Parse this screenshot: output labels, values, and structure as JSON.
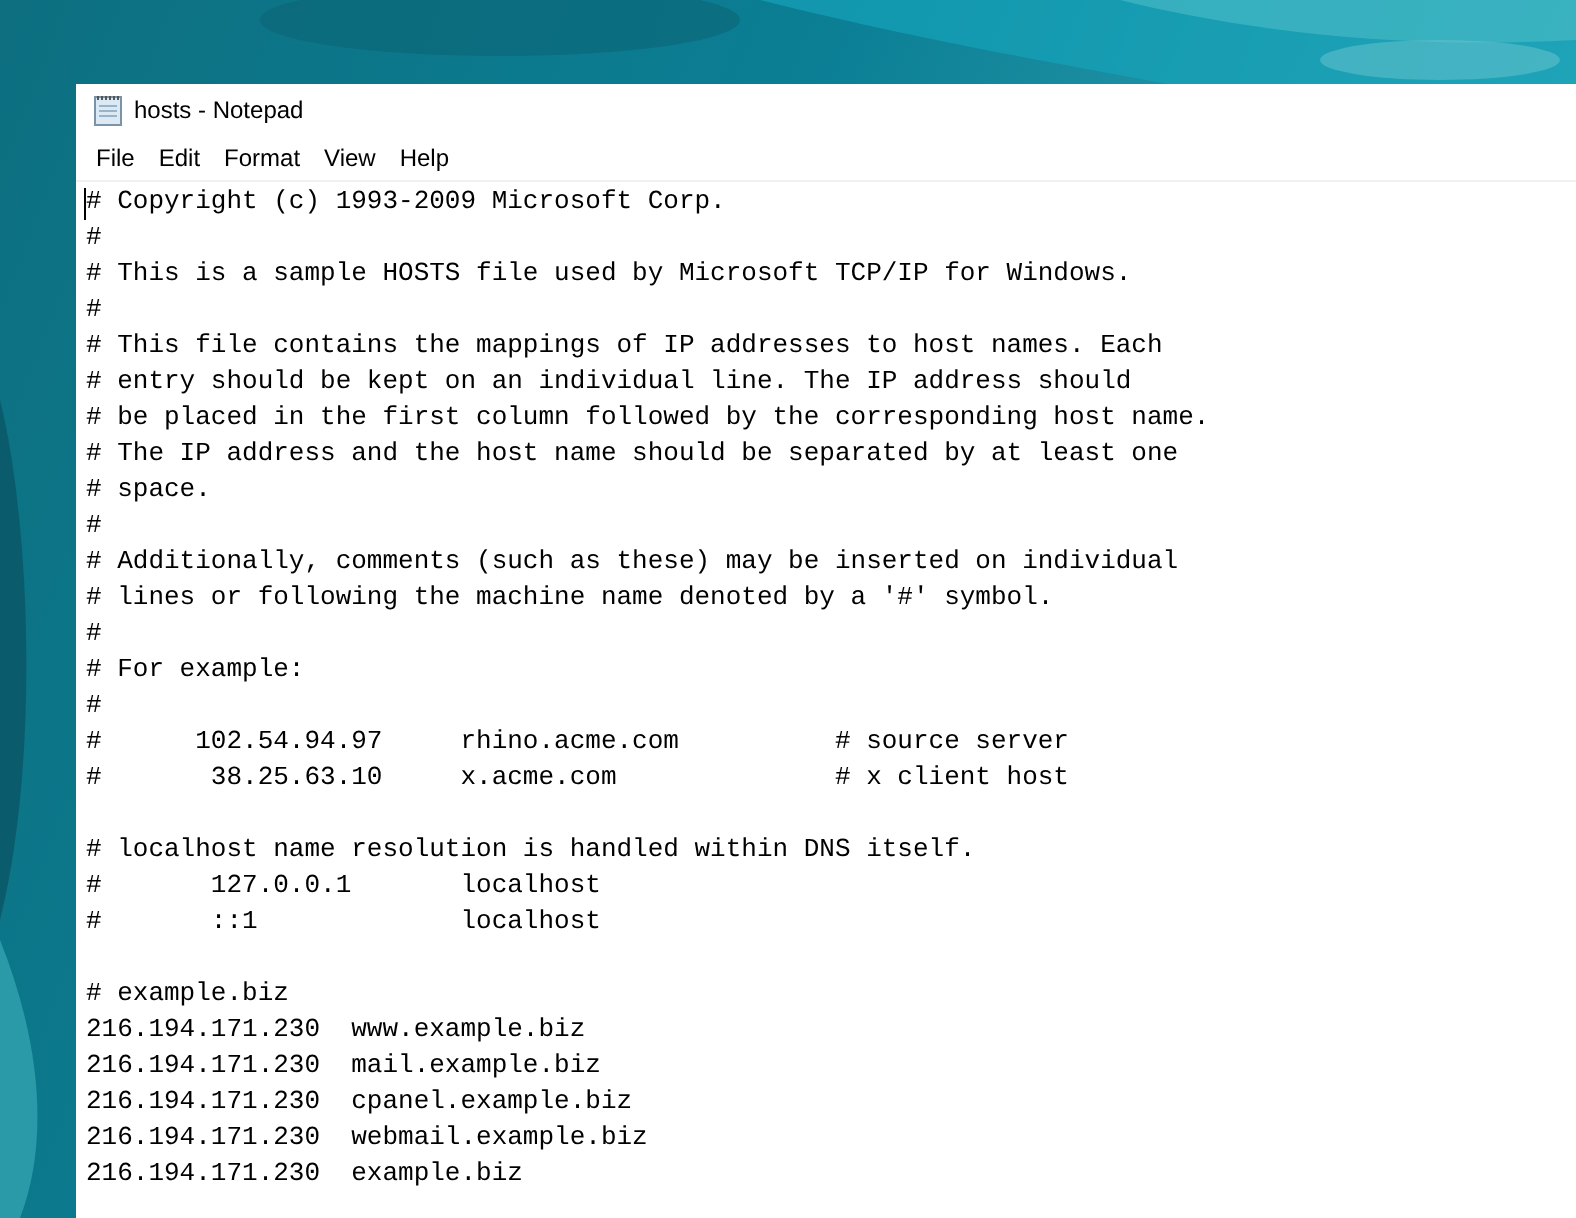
{
  "window": {
    "title": "hosts - Notepad"
  },
  "menu": [
    "File",
    "Edit",
    "Format",
    "View",
    "Help"
  ],
  "editor": {
    "cursor": true,
    "lines": [
      {
        "kind": "text",
        "text": "# Copyright (c) 1993-2009 Microsoft Corp."
      },
      {
        "kind": "text",
        "text": "#"
      },
      {
        "kind": "text",
        "text": "# This is a sample HOSTS file used by Microsoft TCP/IP for Windows."
      },
      {
        "kind": "text",
        "text": "#"
      },
      {
        "kind": "text",
        "text": "# This file contains the mappings of IP addresses to host names. Each"
      },
      {
        "kind": "text",
        "text": "# entry should be kept on an individual line. The IP address should"
      },
      {
        "kind": "text",
        "text": "# be placed in the first column followed by the corresponding host name."
      },
      {
        "kind": "text",
        "text": "# The IP address and the host name should be separated by at least one"
      },
      {
        "kind": "text",
        "text": "# space."
      },
      {
        "kind": "text",
        "text": "#"
      },
      {
        "kind": "text",
        "text": "# Additionally, comments (such as these) may be inserted on individual"
      },
      {
        "kind": "text",
        "text": "# lines or following the machine name denoted by a '#' symbol."
      },
      {
        "kind": "text",
        "text": "#"
      },
      {
        "kind": "text",
        "text": "# For example:"
      },
      {
        "kind": "text",
        "text": "#"
      },
      {
        "kind": "text",
        "text": "#      102.54.94.97     rhino.acme.com          # source server"
      },
      {
        "kind": "text",
        "text": "#       38.25.63.10     x.acme.com              # x client host"
      },
      {
        "kind": "blank"
      },
      {
        "kind": "text",
        "text": "# localhost name resolution is handled within DNS itself."
      },
      {
        "kind": "text",
        "text": "#       127.0.0.1       localhost"
      },
      {
        "kind": "text",
        "text": "#       ::1             localhost"
      },
      {
        "kind": "blank"
      },
      {
        "kind": "text",
        "text": "# example.biz"
      },
      {
        "kind": "text",
        "text": "216.194.171.230  www.example.biz"
      },
      {
        "kind": "text",
        "text": "216.194.171.230  mail.example.biz"
      },
      {
        "kind": "text",
        "text": "216.194.171.230  cpanel.example.biz"
      },
      {
        "kind": "text",
        "text": "216.194.171.230  webmail.example.biz"
      },
      {
        "kind": "text",
        "text": "216.194.171.230  example.biz"
      }
    ]
  }
}
